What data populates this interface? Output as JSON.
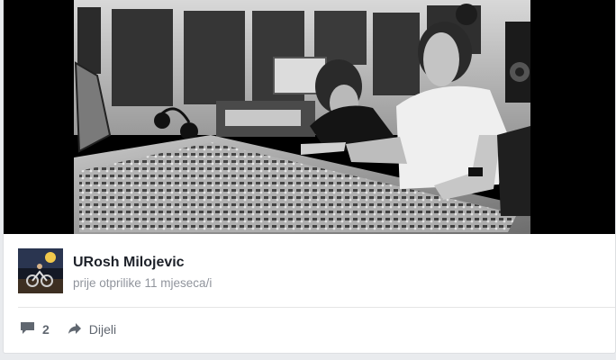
{
  "post": {
    "image_alt": "Two men working at a large analog mixing console in a recording studio (black and white photo)",
    "author_name": "URosh Milojevic",
    "timestamp": "prije otprilike 11 mjeseca/i",
    "comment_count": "2",
    "share_label": "Dijeli"
  },
  "icons": {
    "comment": "comment-icon",
    "share": "share-arrow-icon"
  },
  "colors": {
    "name_text": "#1d2129",
    "meta_text": "#90949c",
    "action_text": "#606770"
  }
}
